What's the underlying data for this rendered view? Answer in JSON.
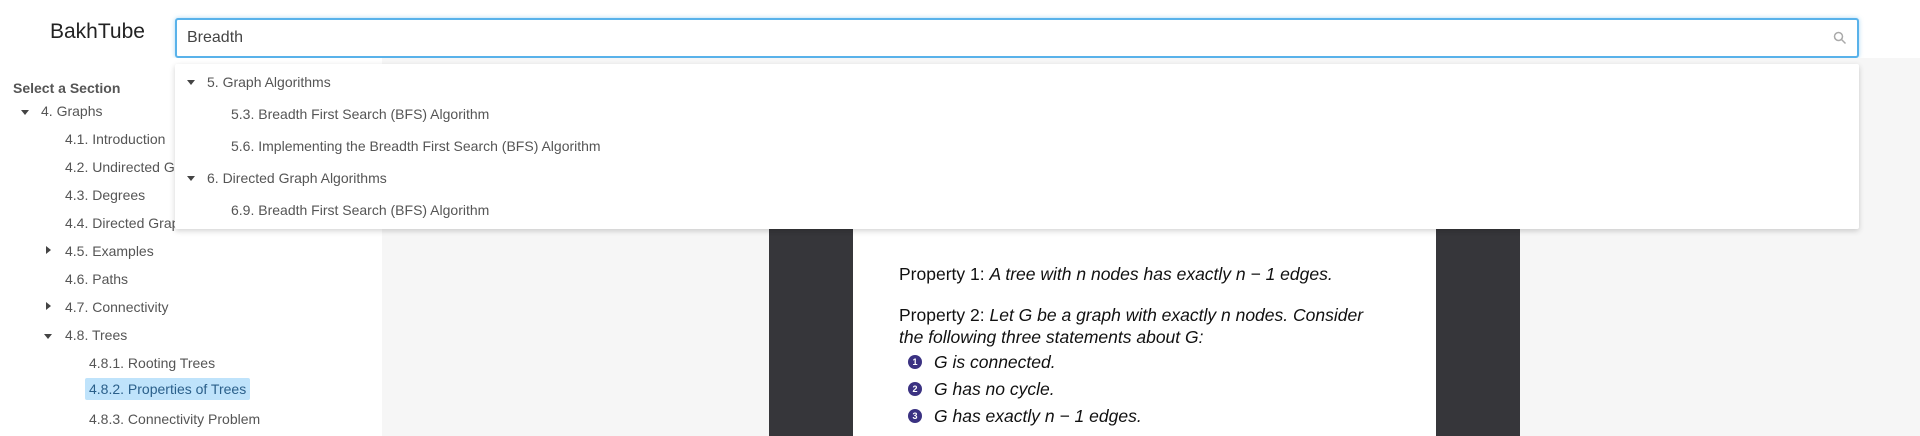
{
  "header": {
    "brand": "BakhTube",
    "search_value": "Breadth"
  },
  "sidebar": {
    "title": "Select a Section",
    "tree": [
      {
        "label": "4. Graphs",
        "caret": "down"
      },
      {
        "label": "4.1. Introduction"
      },
      {
        "label": "4.2. Undirected G"
      },
      {
        "label": "4.3. Degrees"
      },
      {
        "label": "4.4. Directed Grap"
      },
      {
        "label": "4.5. Examples",
        "caret": "right"
      },
      {
        "label": "4.6. Paths"
      },
      {
        "label": "4.7. Connectivity",
        "caret": "right"
      },
      {
        "label": "4.8. Trees",
        "caret": "down"
      },
      {
        "label": "4.8.1. Rooting Trees"
      },
      {
        "label": "4.8.2. Properties of Trees",
        "selected": true
      },
      {
        "label": "4.8.3. Connectivity Problem"
      }
    ]
  },
  "dropdown": {
    "groups": [
      {
        "label": "5. Graph Algorithms",
        "items": [
          "5.3. Breadth First Search (BFS) Algorithm",
          "5.6. Implementing the Breadth First Search (BFS) Algorithm"
        ]
      },
      {
        "label": "6. Directed Graph Algorithms",
        "items": [
          "6.9. Breadth First Search (BFS) Algorithm"
        ]
      }
    ]
  },
  "slide": {
    "p1_label": "Property 1:",
    "p1_text": "A tree with n nodes has exactly n − 1 edges.",
    "p2_label": "Property 2:",
    "p2_text_line1": "Let G be a graph with exactly n nodes. Consider",
    "p2_text_line2": "the following three statements about G:",
    "bullets": [
      {
        "num": "1",
        "text": "G is connected."
      },
      {
        "num": "2",
        "text": "G has no cycle."
      },
      {
        "num": "3",
        "text": "G has exactly n − 1 edges."
      }
    ]
  },
  "colors": {
    "accent": "#59b2ea",
    "selected_bg": "#bfe3fb",
    "slide_frame": "#36363a",
    "bullet": "#3b3282"
  }
}
